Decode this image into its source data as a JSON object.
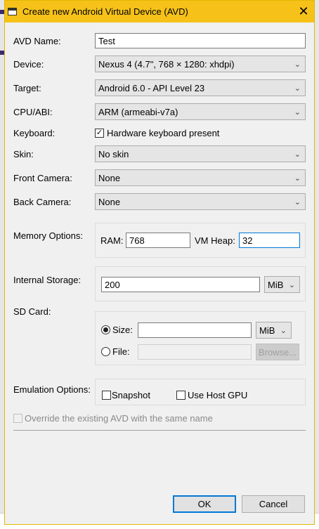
{
  "window": {
    "title": "Create new Android Virtual Device (AVD)",
    "close_glyph": "✕"
  },
  "fields": {
    "avd_name": {
      "label": "AVD Name:",
      "value": "Test"
    },
    "device": {
      "label": "Device:",
      "value": "Nexus 4 (4.7\", 768 × 1280: xhdpi)"
    },
    "target": {
      "label": "Target:",
      "value": "Android 6.0 - API Level 23"
    },
    "cpu": {
      "label": "CPU/ABI:",
      "value": "ARM (armeabi-v7a)"
    },
    "keyboard": {
      "label": "Keyboard:",
      "checkbox_label": "Hardware keyboard present",
      "checked": true
    },
    "skin": {
      "label": "Skin:",
      "value": "No skin"
    },
    "front_camera": {
      "label": "Front Camera:",
      "value": "None"
    },
    "back_camera": {
      "label": "Back Camera:",
      "value": "None"
    }
  },
  "memory": {
    "label": "Memory Options:",
    "ram_label": "RAM:",
    "ram_value": "768",
    "heap_label": "VM Heap:",
    "heap_value": "32"
  },
  "storage": {
    "label": "Internal Storage:",
    "value": "200",
    "unit": "MiB"
  },
  "sdcard": {
    "label": "SD Card:",
    "size_label": "Size:",
    "size_value": "",
    "size_unit": "MiB",
    "file_label": "File:",
    "file_value": "",
    "browse_label": "Browse..."
  },
  "emulation": {
    "label": "Emulation Options:",
    "snapshot_label": "Snapshot",
    "host_gpu_label": "Use Host GPU"
  },
  "override_label": "Override the existing AVD with the same name",
  "buttons": {
    "ok": "OK",
    "cancel": "Cancel"
  },
  "icons": {
    "dropdown": "chevron-down-icon",
    "check": "✓"
  }
}
